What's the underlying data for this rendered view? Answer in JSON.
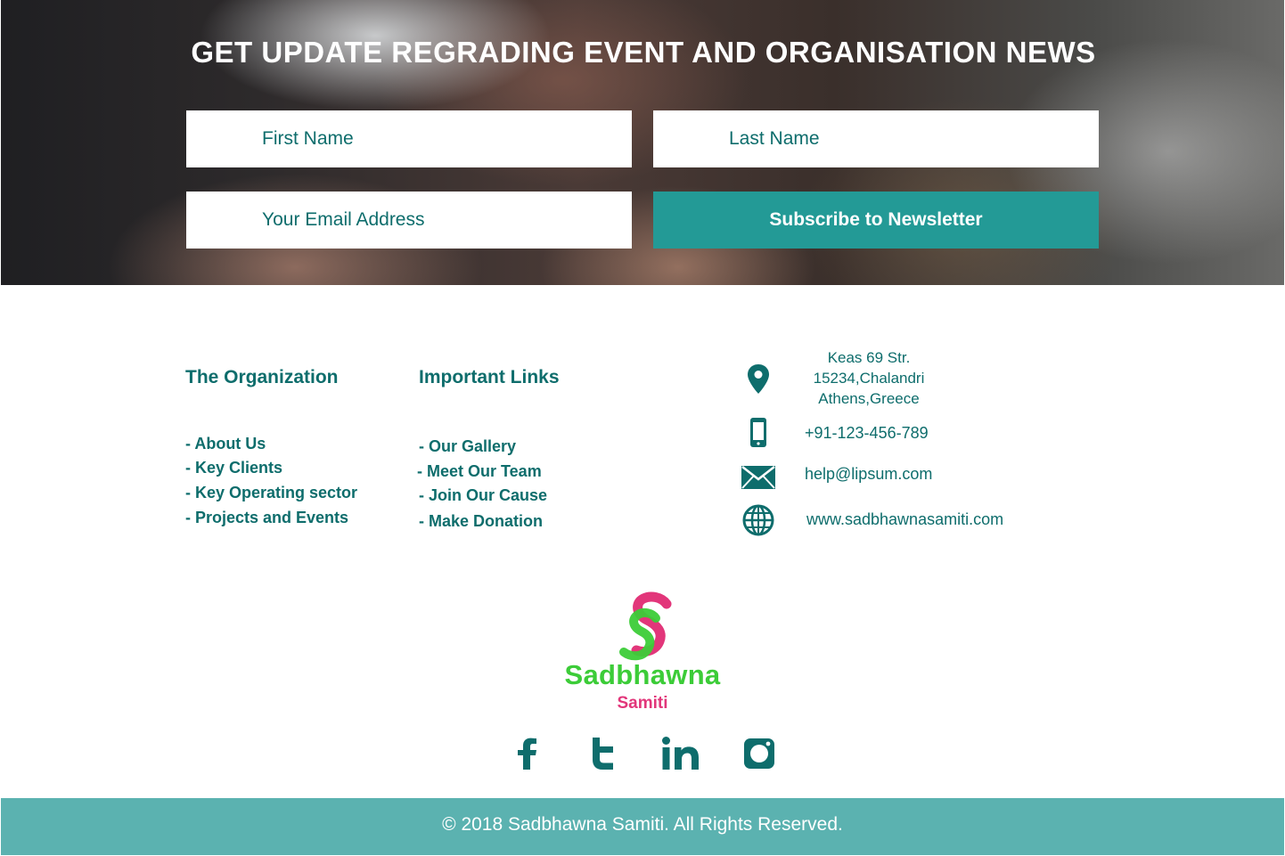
{
  "newsletter": {
    "title": "GET UPDATE REGRADING EVENT AND ORGANISATION NEWS",
    "first_name_placeholder": "First Name",
    "last_name_placeholder": "Last Name",
    "email_placeholder": "Your Email Address",
    "subscribe_label": "Subscribe to Newsletter"
  },
  "organization": {
    "heading": "The Organization",
    "links": [
      "- About Us",
      "- Key Clients",
      "- Key Operating sector",
      "- Projects and Events"
    ]
  },
  "important_links": {
    "heading": "Important Links",
    "links": [
      "- Our Gallery",
      "- Meet Our Team",
      "- Join Our Cause",
      "- Make Donation"
    ]
  },
  "contact": {
    "address_lines": [
      "Keas 69 Str.",
      "15234,Chalandri",
      "Athens,Greece"
    ],
    "phone": "+91-123-456-789",
    "email": "help@lipsum.com",
    "website": "www.sadbhawnasamiti.com",
    "icons": [
      "location-pin-icon",
      "mobile-phone-icon",
      "envelope-icon",
      "globe-icon"
    ]
  },
  "logo": {
    "letter": "S",
    "name": "Sadbhawna",
    "subtitle": "Samiti",
    "colors": {
      "green": "#3ccc38",
      "pink": "#e2367a"
    }
  },
  "social": {
    "icons": [
      "facebook-icon",
      "twitter-icon",
      "linkedin-icon",
      "instagram-icon"
    ]
  },
  "footer": {
    "copyright": "© 2018 Sadbhawna Samiti. All Rights Reserved."
  },
  "colors": {
    "primary_text": "#0e6d6c",
    "subscribe_button": "#239a96",
    "copyright_bar": "#5bb2b0"
  }
}
